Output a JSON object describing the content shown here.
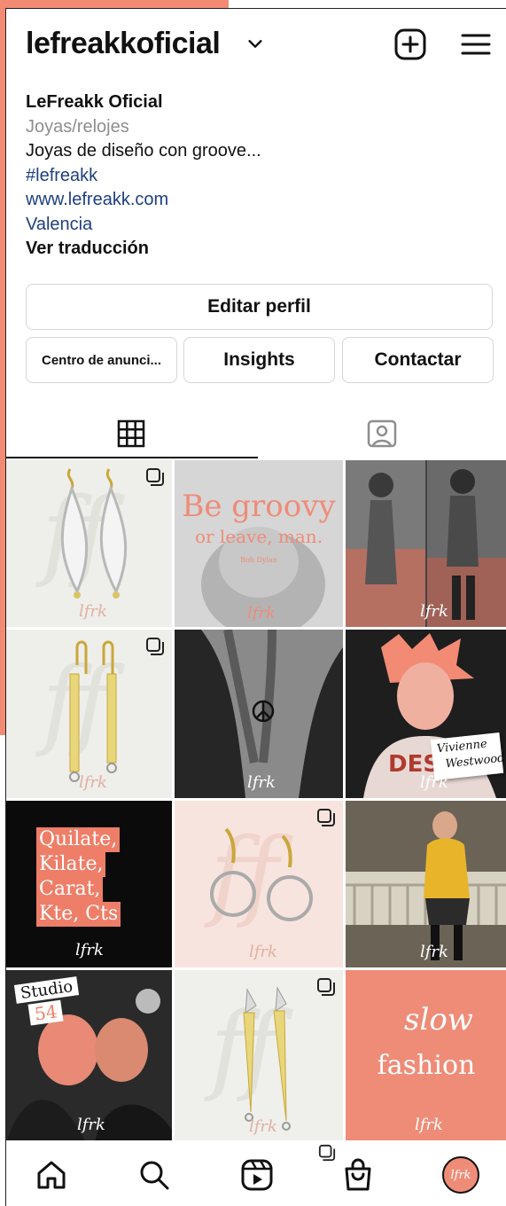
{
  "header": {
    "username": "lefreakkoficial"
  },
  "profile": {
    "name": "LeFreakk Oficial",
    "category": "Joyas/relojes",
    "description": "Joyas de diseño con groove...",
    "hashtag": "#lefreakk",
    "website": "www.lefreakk.com",
    "location": "Valencia",
    "translate": "Ver traducción"
  },
  "buttons": {
    "edit": "Editar perfil",
    "ads": "Centro de anunci...",
    "insights": "Insights",
    "contact": "Contactar"
  },
  "posts": {
    "groovy_title": "Be groovy",
    "groovy_sub": "or leave, man.",
    "groovy_credit": "Bob Dylan",
    "vivienne_line1": "Vivienne",
    "vivienne_line2": "Westwood.",
    "units": [
      "Quilate,",
      "Kilate,",
      "Carat,",
      "Kte, Cts"
    ],
    "studio_line1": "Studio",
    "studio_line2": "54",
    "slow_line1": "slow",
    "slow_line2": "fashion",
    "brand_mark": "lfrk"
  },
  "colors": {
    "accent": "#f28a74",
    "link": "#1e3f80",
    "salmon_tile": "#ee8c78"
  },
  "icons": [
    "chevron-down-icon",
    "new-post-icon",
    "menu-icon",
    "grid-icon",
    "tagged-icon",
    "home-icon",
    "search-icon",
    "reels-icon",
    "shop-icon",
    "profile-avatar"
  ]
}
